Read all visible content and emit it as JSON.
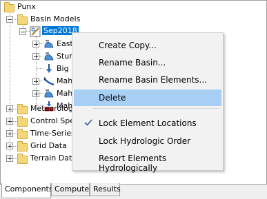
{
  "tree": {
    "root": "Punx",
    "basin_models": "Basin Models",
    "selected_basin": "Sep2018",
    "elements": [
      "East",
      "Stum",
      "Big F",
      "Mah",
      "Mah",
      "Mah"
    ],
    "folders": [
      "Meteorologic",
      "Control Spec",
      "Time-Series",
      "Grid Data",
      "Terrain Data"
    ]
  },
  "context_menu": {
    "items": [
      {
        "label": "Create Copy..."
      },
      {
        "label": "Rename Basin..."
      },
      {
        "label": "Rename Basin Elements..."
      },
      {
        "label": "Delete",
        "highlighted": true
      },
      {
        "label": "Lock Element Locations",
        "checked": true
      },
      {
        "label": "Lock Hydrologic Order"
      },
      {
        "label": "Resort Elements Hydrologically"
      }
    ]
  },
  "tabs": {
    "components": "Components",
    "compute": "Compute",
    "results": "Results"
  },
  "colors": {
    "selection": "#0078d7",
    "menu_highlight": "#a8d0f5"
  }
}
